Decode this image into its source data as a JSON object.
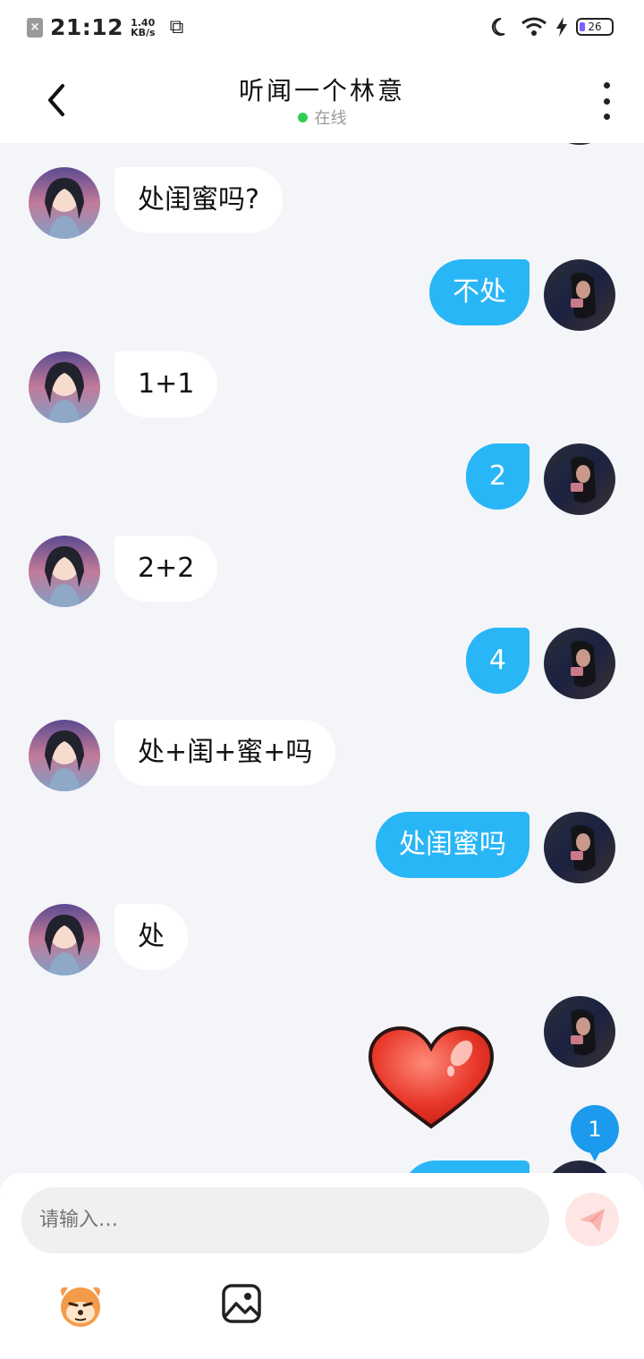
{
  "status_bar": {
    "time": "21:12",
    "speed_value": "1.40",
    "speed_unit": "KB/s",
    "battery": "26"
  },
  "header": {
    "title": "听闻一个林意",
    "presence": "在线"
  },
  "messages": [
    {
      "side": "in",
      "text": "处闺蜜吗?"
    },
    {
      "side": "out",
      "text": "不处"
    },
    {
      "side": "in",
      "text": "1+1"
    },
    {
      "side": "out",
      "text": "2"
    },
    {
      "side": "in",
      "text": "2+2"
    },
    {
      "side": "out",
      "text": "4"
    },
    {
      "side": "in",
      "text": "处+闺+蜜+吗"
    },
    {
      "side": "out",
      "text": "处闺蜜吗"
    },
    {
      "side": "in",
      "text": "处"
    },
    {
      "side": "out",
      "type": "sticker",
      "sticker": "heart"
    }
  ],
  "unread_badge": "1",
  "input": {
    "placeholder": "请输入…"
  },
  "colors": {
    "outgoing_bubble": "#29b6f6",
    "incoming_bubble": "#ffffff",
    "online_dot": "#33cc55",
    "background": "#f3f5f8"
  }
}
